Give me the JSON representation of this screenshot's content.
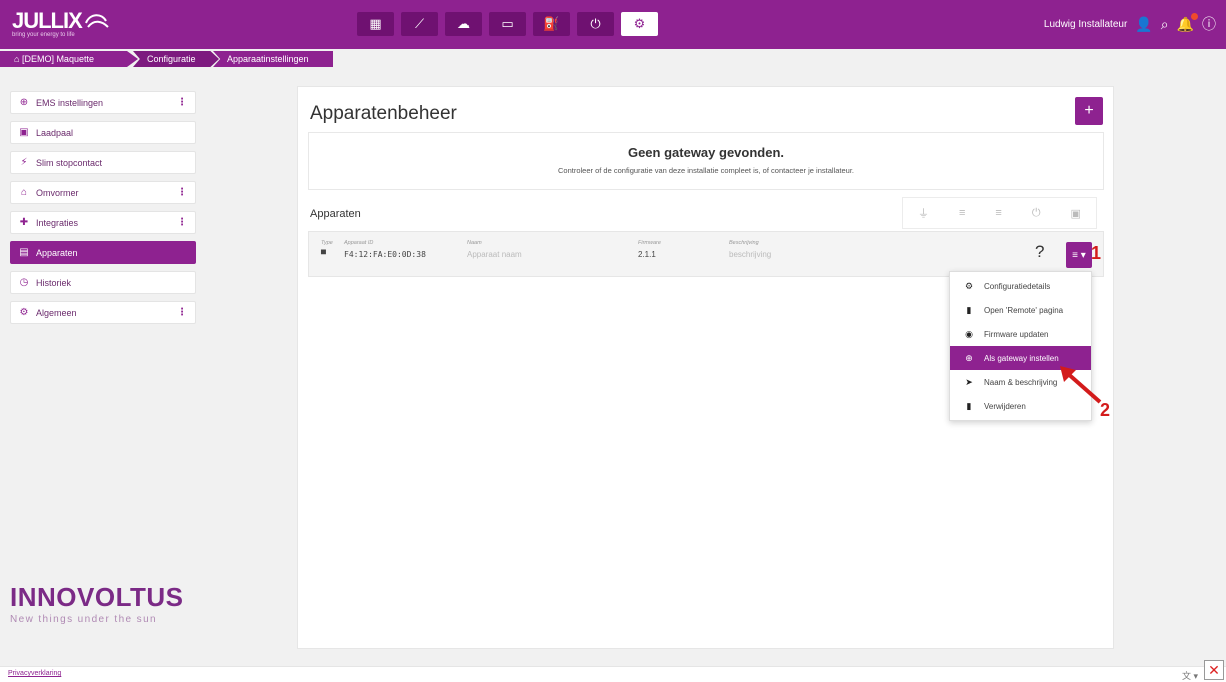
{
  "app": {
    "logo": "JULLIX",
    "logo_tagline": "bring your energy to life"
  },
  "nav": {
    "items": [
      {
        "icon": "dashboard-icon",
        "glyph": "▦"
      },
      {
        "icon": "chart-icon",
        "glyph": "⟋"
      },
      {
        "icon": "brain-icon",
        "glyph": "☁"
      },
      {
        "icon": "battery-icon",
        "glyph": "▭"
      },
      {
        "icon": "ev-charger-icon",
        "glyph": "⛽"
      },
      {
        "icon": "plug-icon",
        "glyph": "⏻"
      },
      {
        "icon": "settings-icon",
        "glyph": "⚙",
        "active": true
      }
    ]
  },
  "user": {
    "name": "Ludwig Installateur"
  },
  "breadcrumb": {
    "home": "[DEMO] Maquette",
    "config": "Configuratie",
    "current": "Apparaatinstellingen"
  },
  "sidebar": {
    "items": [
      {
        "label": "EMS instellingen",
        "icon": "ems-icon",
        "glyph": "⊕",
        "more": true
      },
      {
        "label": "Laadpaal",
        "icon": "ev-charger-icon",
        "glyph": "▣",
        "more": false
      },
      {
        "label": "Slim stopcontact",
        "icon": "plug-icon",
        "glyph": "⚡",
        "more": false
      },
      {
        "label": "Omvormer",
        "icon": "house-icon",
        "glyph": "⌂",
        "more": true
      },
      {
        "label": "Integraties",
        "icon": "puzzle-icon",
        "glyph": "✚",
        "more": true
      },
      {
        "label": "Apparaten",
        "icon": "devices-icon",
        "glyph": "▤",
        "more": false,
        "active": true
      },
      {
        "label": "Historiek",
        "icon": "history-icon",
        "glyph": "◷",
        "more": false
      },
      {
        "label": "Algemeen",
        "icon": "gear-icon",
        "glyph": "⚙",
        "more": true
      }
    ],
    "more_glyph": "⋮"
  },
  "brand": {
    "name": "INNOVOLTUS",
    "slogan": "New things under the sun"
  },
  "main": {
    "title": "Apparatenbeheer",
    "add_label": "+",
    "notice_title": "Geen gateway gevonden.",
    "notice_text": "Controleer of de configuratie van deze installatie compleet is, of contacteer je installateur.",
    "section_title": "Apparaten",
    "filter_icons": [
      "meter-icon",
      "gateway-icon",
      "battery-icon",
      "plug-icon",
      "charger-icon"
    ],
    "filter_glyphs": [
      "⏚",
      "≡",
      "≡",
      "⏻",
      "▣"
    ]
  },
  "device": {
    "headers": {
      "type": "Type",
      "id": "Apparaat ID",
      "name": "Naam",
      "firmware": "Firmware",
      "description": "Beschrijving"
    },
    "type_glyph": "▀",
    "id": "F4:12:FA:E0:0D:38",
    "name_placeholder": "Apparaat naam",
    "firmware": "2.1.1",
    "description_placeholder": "beschrijving",
    "help": "?",
    "menu_label": "≡ ▾"
  },
  "annotations": {
    "one": "1",
    "two": "2"
  },
  "dropdown": {
    "items": [
      {
        "label": "Configuratiedetails",
        "icon": "gear-icon",
        "glyph": "⚙"
      },
      {
        "label": "Open 'Remote' pagina",
        "icon": "remote-icon",
        "glyph": "▮"
      },
      {
        "label": "Firmware updaten",
        "icon": "globe-icon",
        "glyph": "◉"
      },
      {
        "label": "Als gateway instellen",
        "icon": "gateway-icon",
        "glyph": "⊕",
        "active": true
      },
      {
        "label": "Naam & beschrijving",
        "icon": "tag-icon",
        "glyph": "➤"
      },
      {
        "label": "Verwijderen",
        "icon": "trash-icon",
        "glyph": "▮"
      }
    ]
  },
  "footer": {
    "privacy": "Privacyverklaring",
    "lang": "文 ▾",
    "close": "✕"
  },
  "colors": {
    "brand": "#8e2290",
    "annotation": "#d31b1b"
  }
}
